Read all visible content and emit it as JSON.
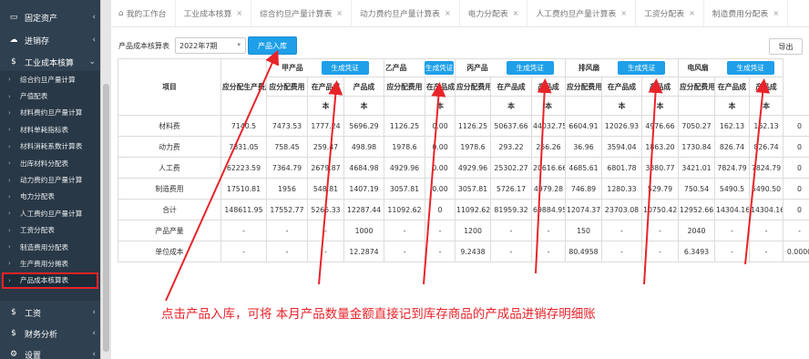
{
  "sidebar": {
    "top_items": [
      {
        "icon": "monitor-icon",
        "label": "固定资产"
      },
      {
        "icon": "cloud-icon",
        "label": "进销存"
      },
      {
        "icon": "dollar-icon",
        "label": "工业成本核算"
      }
    ],
    "sub_items": [
      "综合约旦产量计算",
      "产值配表",
      "材料费约旦产量计算",
      "材料单耗指标表",
      "材料消耗系数计算表",
      "出库材料分配表",
      "动力费约旦产量计算",
      "电力分配表",
      "人工费约旦产量计算",
      "工资分配表",
      "制造费用分配表",
      "生产费用分摊表",
      "产品成本核算表"
    ],
    "bottom_items": [
      {
        "icon": "dollar-icon",
        "label": "工资"
      },
      {
        "icon": "dollar-icon",
        "label": "财务分析"
      },
      {
        "icon": "gear-icon",
        "label": "设置"
      }
    ]
  },
  "tabs": [
    "我的工作台",
    "工业成本核算",
    "综合约旦产量计算表",
    "动力费约旦产量计算表",
    "电力分配表",
    "人工费约旦产量计算表",
    "工资分配表",
    "制造费用分配表"
  ],
  "toolbar": {
    "label": "产品成本核算表",
    "period": "2022年7期",
    "stock_in_label": "产品入库",
    "export_label": "导出"
  },
  "table": {
    "item_header": "项目",
    "total_alloc_header": "应分配生产费用",
    "generate_label": "生成凭证",
    "sub_headers": [
      "应分配费用",
      "在产品成本",
      "产品成本"
    ],
    "products": [
      "甲产品",
      "乙产品",
      "丙产品",
      "排风扇",
      "电风扇"
    ],
    "rows": [
      {
        "label": "材料费",
        "cells": [
          "7140.5",
          "7473.53",
          "1777.24",
          "5696.29",
          "1126.25",
          "0.00",
          "1126.25",
          "50637.66",
          "44032.75",
          "6604.91",
          "12026.93",
          "4976.66",
          "7050.27",
          "162.13",
          "162.13",
          "0"
        ]
      },
      {
        "label": "动力费",
        "cells": [
          "7331.05",
          "758.45",
          "259.47",
          "498.98",
          "1978.6",
          "0.00",
          "1978.6",
          "293.22",
          "256.26",
          "36.96",
          "3594.04",
          "1863.20",
          "1730.84",
          "826.74",
          "826.74",
          "0"
        ]
      },
      {
        "label": "人工费",
        "cells": [
          "62223.59",
          "7364.79",
          "2679.87",
          "4684.98",
          "4929.96",
          "0.00",
          "4929.96",
          "25302.27",
          "20616.66",
          "4685.61",
          "6801.78",
          "3380.77",
          "3421.01",
          "7824.79",
          "7824.79",
          "0"
        ]
      },
      {
        "label": "制造费用",
        "cells": [
          "17510.81",
          "1956",
          "548.81",
          "1407.19",
          "3057.81",
          "0.00",
          "3057.81",
          "5726.17",
          "4979.28",
          "746.89",
          "1280.33",
          "529.79",
          "750.54",
          "5490.5",
          "5490.50",
          "0"
        ]
      },
      {
        "label": "合计",
        "cells": [
          "148611.95",
          "17552.77",
          "5265.33",
          "12287.44",
          "11092.62",
          "0",
          "11092.62",
          "81959.32",
          "69884.95",
          "12074.37",
          "23703.08",
          "10750.42",
          "12952.66",
          "14304.16",
          "14304.16",
          "0"
        ]
      },
      {
        "label": "产品产量",
        "cells": [
          "-",
          "-",
          "-",
          "1000",
          "-",
          "-",
          "1200",
          "-",
          "-",
          "150",
          "-",
          "-",
          "2040",
          "-",
          "-",
          "-"
        ]
      },
      {
        "label": "单位成本",
        "cells": [
          "-",
          "-",
          "-",
          "12.2874",
          "-",
          "-",
          "9.2438",
          "-",
          "-",
          "80.4958",
          "-",
          "-",
          "6.3493",
          "-",
          "-",
          "0.0000"
        ]
      }
    ]
  },
  "annotation": {
    "text": "点击产品入库，可将 本月产品数量金额直接记到库存商品的产成品进销存明细账",
    "color": "#e8232a"
  },
  "colors": {
    "sidebar_bg": "#2f4050",
    "accent_button": "#1e9fe8",
    "highlight_red": "#e8232a"
  }
}
